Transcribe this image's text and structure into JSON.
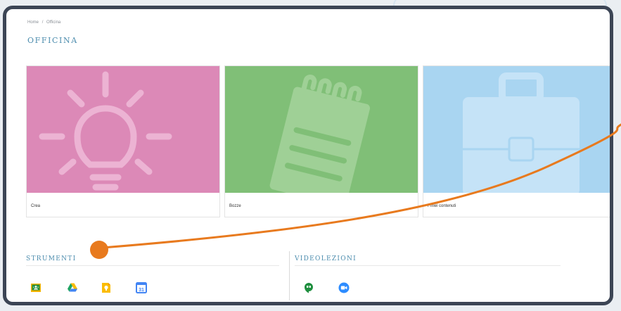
{
  "breadcrumb": {
    "home": "Home",
    "separator": "/",
    "current": "Officina"
  },
  "page": {
    "title": "OFFICINA"
  },
  "cards": [
    {
      "label": "Crea",
      "icon": "lightbulb-icon",
      "color": "#dc89b7"
    },
    {
      "label": "Bozze",
      "icon": "notepad-icon",
      "color": "#80bf77"
    },
    {
      "label": "I miei contenuti",
      "icon": "briefcase-icon",
      "color": "#a9d5f1"
    }
  ],
  "strumenti": {
    "title": "STRUMENTI",
    "tools": [
      "google-classroom-icon",
      "google-drive-icon",
      "google-keep-icon",
      "google-calendar-icon"
    ],
    "calendar_day": "31"
  },
  "videolezioni": {
    "title": "VIDEOLEZIONI",
    "tools": [
      "google-meet-hangouts-icon",
      "zoom-icon"
    ]
  },
  "colors": {
    "accent_title": "#4d8dae",
    "pointer": "#e87a1e",
    "frame": "#3c4555"
  }
}
